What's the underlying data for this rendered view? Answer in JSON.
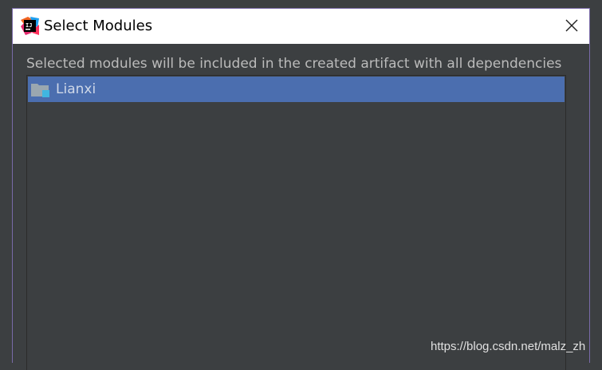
{
  "window": {
    "title": "Select Modules",
    "app_icon": "intellij-idea-icon",
    "close_icon": "close-icon"
  },
  "description": "Selected modules will be included in the created artifact with all dependencies",
  "modules": [
    {
      "label": "Lianxi",
      "icon": "module-folder-icon",
      "selected": true
    }
  ],
  "colors": {
    "titlebar_bg": "#ffffff",
    "dialog_bg": "#3c3f41",
    "selection_bg": "#4b6eaf",
    "text_muted": "#bbbbbb",
    "text_selected": "#cfd8e8"
  },
  "watermark": "https://blog.csdn.net/malz_zh"
}
